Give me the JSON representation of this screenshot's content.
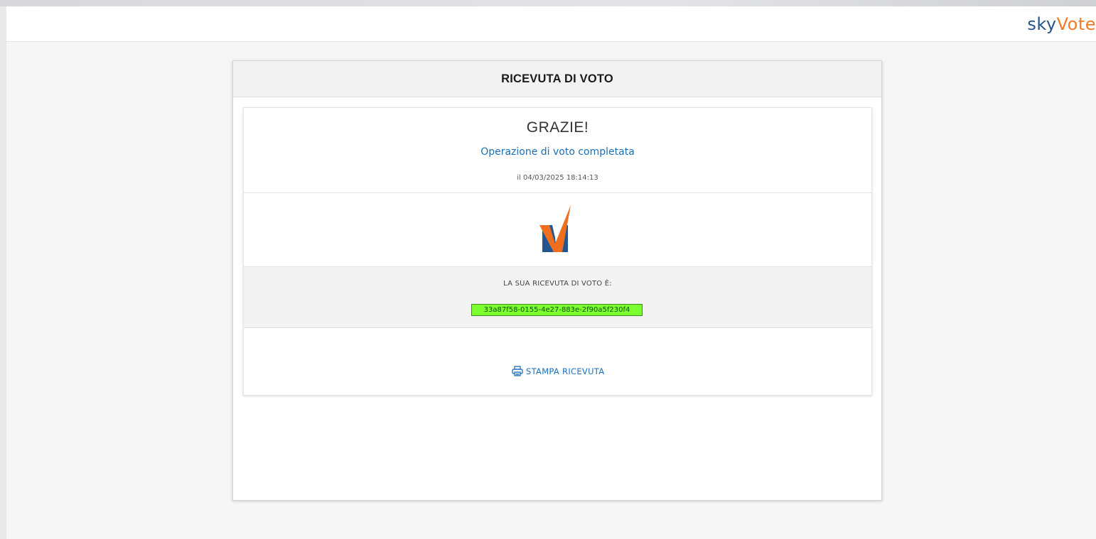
{
  "brand": {
    "logo_part1": "sky",
    "logo_part2": "Vote",
    "color_primary": "#24558f",
    "color_accent": "#ef7c27"
  },
  "card": {
    "title": "RICEVUTA DI VOTO"
  },
  "confirmation": {
    "title": "GRAZIE!",
    "subtitle": "Operazione di voto completata",
    "date": "il 04/03/2025 18:14:13"
  },
  "receipt": {
    "label": "LA SUA RICEVUTA DI VOTO È:",
    "code": "33a87f58-0155-4e27-883e-2f90a5f230f4",
    "highlight_color": "#7cff2f"
  },
  "actions": {
    "print_label": "STAMPA RICEVUTA",
    "print_icon": "printer-icon"
  },
  "link_color": "#1a6fb7"
}
